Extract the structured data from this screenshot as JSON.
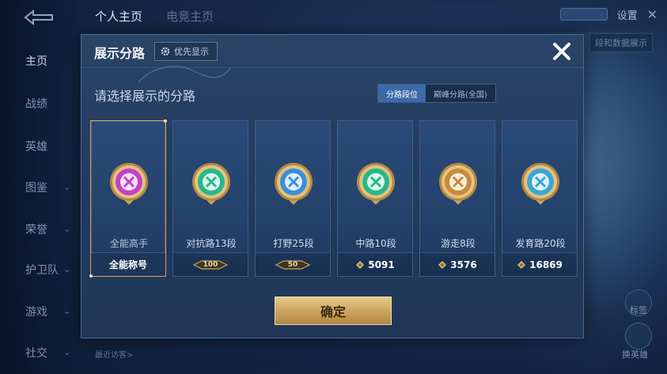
{
  "background": {
    "top_tabs": [
      {
        "label": "个人主页",
        "active": true
      },
      {
        "label": "电竞主页",
        "active": false
      }
    ],
    "settings_label": "设置",
    "side_tag": "段和数据展示",
    "nav_items": [
      {
        "label": "主页",
        "active": true,
        "has_chevron": false
      },
      {
        "label": "战绩",
        "active": false,
        "has_chevron": false
      },
      {
        "label": "英雄",
        "active": false,
        "has_chevron": false
      },
      {
        "label": "图鉴",
        "active": false,
        "has_chevron": true
      },
      {
        "label": "荣誉",
        "active": false,
        "has_chevron": true
      },
      {
        "label": "护卫队",
        "active": false,
        "has_chevron": true
      },
      {
        "label": "游戏",
        "active": false,
        "has_chevron": true
      },
      {
        "label": "社交",
        "active": false,
        "has_chevron": true
      }
    ],
    "recent_visitors": "最近访客>",
    "right_labels": [
      "标签",
      "换英雄"
    ]
  },
  "modal": {
    "title": "展示分路",
    "priority_label": "优先显示",
    "prompt": "请选择展示的分路",
    "segments": [
      {
        "label": "分路段位",
        "active": true
      },
      {
        "label": "巅峰分路(全国)",
        "active": false
      }
    ],
    "cards": [
      {
        "label": "全能高手",
        "footer": "全能称号",
        "footer_type": "text",
        "icon": "all-round-badge-icon",
        "color": "#c33fc8",
        "selected": true
      },
      {
        "label": "对抗路13段",
        "footer": "100",
        "footer_type": "emblem",
        "icon": "clash-lane-badge-icon",
        "color": "#27b88a",
        "selected": false
      },
      {
        "label": "打野25段",
        "footer": "50",
        "footer_type": "emblem",
        "icon": "jungle-badge-icon",
        "color": "#3a8fd8",
        "selected": false
      },
      {
        "label": "中路10段",
        "footer": "5091",
        "footer_type": "coin",
        "icon": "mid-lane-badge-icon",
        "color": "#27b88a",
        "selected": false
      },
      {
        "label": "游走8段",
        "footer": "3576",
        "footer_type": "coin",
        "icon": "roam-badge-icon",
        "color": "#c98a3a",
        "selected": false
      },
      {
        "label": "发育路20段",
        "footer": "16869",
        "footer_type": "coin",
        "icon": "farm-lane-badge-icon",
        "color": "#3aa6d8",
        "selected": false
      }
    ],
    "confirm_label": "确定"
  },
  "colors": {
    "accent_blue": "#3c6aa8",
    "gold": "#c9a25b",
    "selected_border": "#cfa566"
  }
}
